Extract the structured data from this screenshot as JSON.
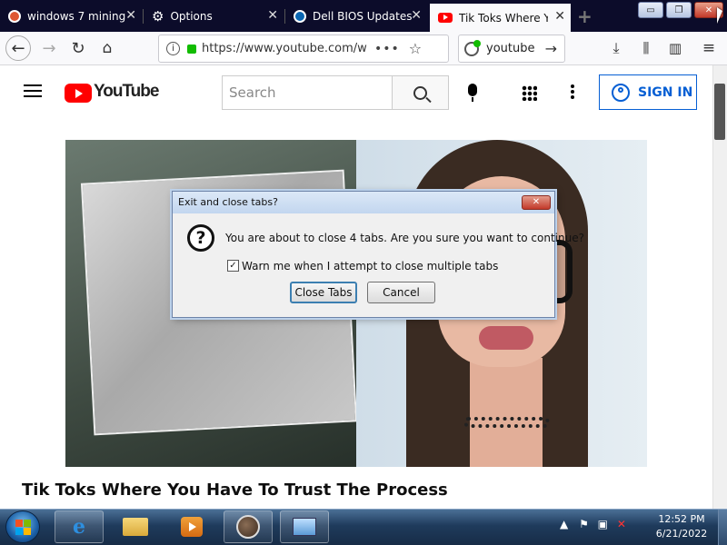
{
  "browser": {
    "tabs": [
      {
        "label": "windows 7 mining",
        "icon": "duckduckgo-icon",
        "color": "#de5833"
      },
      {
        "label": "Options",
        "icon": "gear-icon",
        "color": "#ffffff"
      },
      {
        "label": "Dell BIOS Updates",
        "icon": "dell-icon",
        "color": "#0a66b2"
      },
      {
        "label": "Tik Toks Where You Have To Trust The Process",
        "icon": "youtube-icon",
        "color": "#ff0000",
        "active": true
      }
    ],
    "url": "https://www.youtube.com/watch",
    "search_engine_text": "youtube",
    "window_controls": {
      "minimize": "▭",
      "restore": "❐",
      "close": "✕"
    }
  },
  "youtube": {
    "logo_text": "YouTube",
    "search_placeholder": "Search",
    "sign_in_label": "SIGN IN",
    "brand_color": "#ff0000",
    "accent_color": "#065fd4",
    "video_title": "Tik Toks Where You Have To Trust The Process"
  },
  "dialog": {
    "title": "Exit and close tabs?",
    "message": "You are about to close 4 tabs. Are you sure you want to continue?",
    "checkbox_label": "Warn me when I attempt to close multiple tabs",
    "checkbox_checked": true,
    "primary_button": "Close Tabs",
    "cancel_button": "Cancel"
  },
  "taskbar": {
    "items": [
      "internet-explorer-icon",
      "file-explorer-icon",
      "media-player-icon",
      "firefox-icon",
      "control-panel-icon"
    ],
    "clock_time": "12:52 PM",
    "clock_date": "6/21/2022"
  }
}
